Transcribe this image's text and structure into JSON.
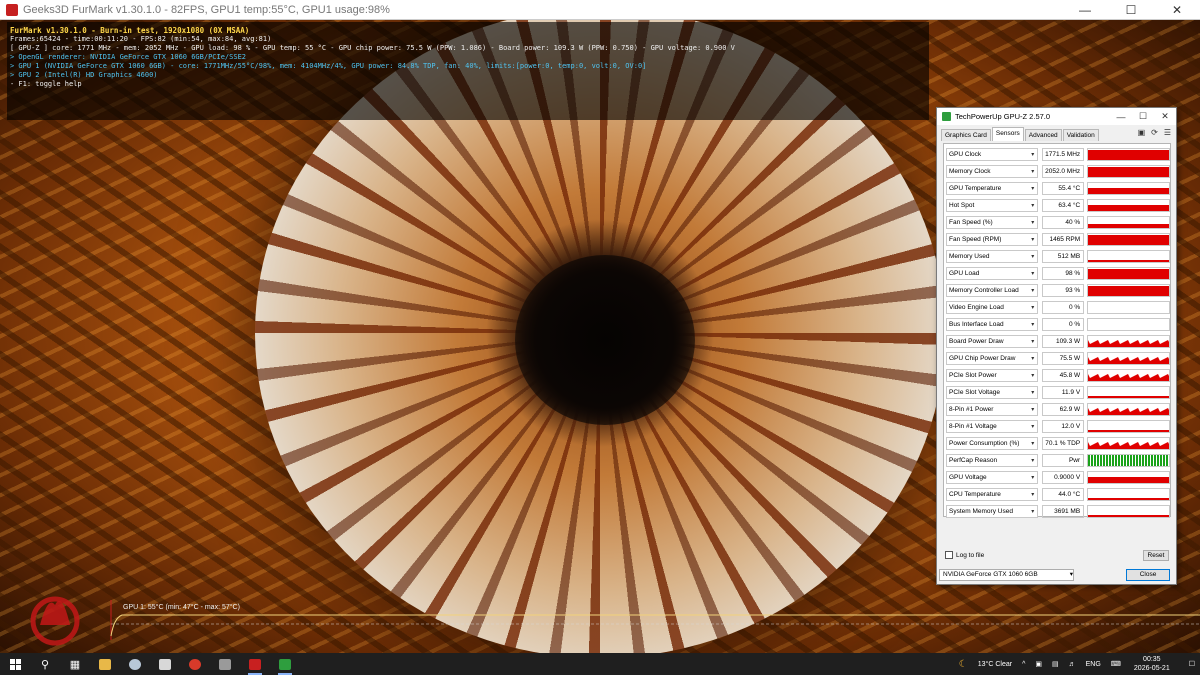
{
  "furmark": {
    "window_title": "Geeks3D FurMark v1.30.1.0 - 82FPS, GPU1 temp:55°C, GPU1 usage:98%",
    "osd": [
      {
        "text": "FurMark v1.30.1.0 - Burn-in test, 1920x1080 (0X MSAA)",
        "style": "l1"
      },
      {
        "text": "Frames:65424 - time:00:11:20 - FPS:82 (min:54, max:84, avg:81)",
        "style": "lw"
      },
      {
        "text": "[ GPU-Z ] core: 1771 MHz - mem: 2052 MHz - GPU load: 98 % - GPU temp: 55 °C - GPU chip power: 75.5 W (PPW: 1.086) - Board power: 109.3 W (PPW: 0.750) - GPU voltage: 0.900 V",
        "style": "lw"
      },
      {
        "text": "> OpenGL renderer: NVIDIA GeForce GTX 1060 6GB/PCIe/SSE2",
        "style": "lc"
      },
      {
        "text": "> GPU 1 (NVIDIA GeForce GTX 1060 6GB) - core: 1771MHz/55°C/98%, mem: 4104MHz/4%, GPU power: 84.8% TDP, fan: 40%, limits:[power:0, temp:0, volt:0, OV:0]",
        "style": "lc"
      },
      {
        "text": "> GPU 2 (Intel(R) HD Graphics 4600)",
        "style": "lc"
      },
      {
        "text": "- F1: toggle help",
        "style": "lw"
      }
    ],
    "temp_graph_label": "GPU 1: 55°C (min: 47°C - max: 57°C)"
  },
  "gpuz": {
    "title": "TechPowerUp GPU-Z 2.57.0",
    "tabs": [
      "Graphics Card",
      "Sensors",
      "Advanced",
      "Validation"
    ],
    "active_tab": "Sensors",
    "sensors": [
      {
        "name": "GPU Clock",
        "value": "1771.5 MHz",
        "graph": "full"
      },
      {
        "name": "Memory Clock",
        "value": "2052.0 MHz",
        "graph": "full"
      },
      {
        "name": "GPU Temperature",
        "value": "55.4 °C",
        "graph": "mid"
      },
      {
        "name": "Hot Spot",
        "value": "63.4 °C",
        "graph": "mid"
      },
      {
        "name": "Fan Speed (%)",
        "value": "40 %",
        "graph": "low"
      },
      {
        "name": "Fan Speed (RPM)",
        "value": "1465 RPM",
        "graph": "full"
      },
      {
        "name": "Memory Used",
        "value": "512 MB",
        "graph": "thin"
      },
      {
        "name": "GPU Load",
        "value": "98 %",
        "graph": "full"
      },
      {
        "name": "Memory Controller Load",
        "value": "93 %",
        "graph": "full"
      },
      {
        "name": "Video Engine Load",
        "value": "0 %",
        "graph": "none"
      },
      {
        "name": "Bus Interface Load",
        "value": "0 %",
        "graph": "none"
      },
      {
        "name": "Board Power Draw",
        "value": "109.3 W",
        "graph": "noisy"
      },
      {
        "name": "GPU Chip Power Draw",
        "value": "75.5 W",
        "graph": "noisy"
      },
      {
        "name": "PCIe Slot Power",
        "value": "45.8 W",
        "graph": "noisy"
      },
      {
        "name": "PCIe Slot Voltage",
        "value": "11.9 V",
        "graph": "thin"
      },
      {
        "name": "8-Pin #1 Power",
        "value": "62.9 W",
        "graph": "noisy"
      },
      {
        "name": "8-Pin #1 Voltage",
        "value": "12.0 V",
        "graph": "thin"
      },
      {
        "name": "Power Consumption (%)",
        "value": "70.1 % TDP",
        "graph": "noisy"
      },
      {
        "name": "PerfCap Reason",
        "value": "Pwr",
        "graph": "green"
      },
      {
        "name": "GPU Voltage",
        "value": "0.9000 V",
        "graph": "mid"
      },
      {
        "name": "CPU Temperature",
        "value": "44.0 °C",
        "graph": "thin"
      },
      {
        "name": "System Memory Used",
        "value": "3691 MB",
        "graph": "thin"
      }
    ],
    "log_to_file": "Log to file",
    "reset_label": "Reset",
    "gpu_select": "NVIDIA GeForce GTX 1060 6GB",
    "close_label": "Close",
    "graph_color": "#e00000",
    "perfcap_color": "#1aa21a"
  },
  "taskbar": {
    "weather": "13°C  Clear",
    "language": "ENG",
    "time": "00:35",
    "date": "2026-05-21"
  }
}
